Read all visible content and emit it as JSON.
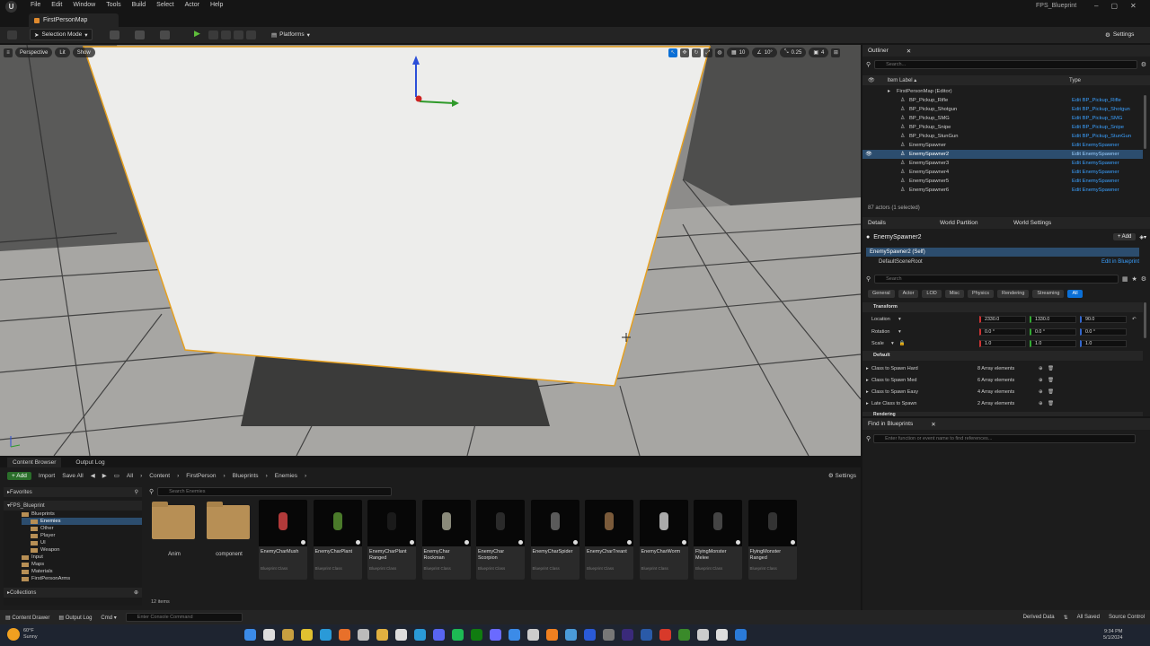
{
  "titlebar": {
    "logo": "U",
    "menu": [
      "File",
      "Edit",
      "Window",
      "Tools",
      "Build",
      "Select",
      "Actor",
      "Help"
    ],
    "project": "FPS_Blueprint",
    "tab": "FirstPersonMap",
    "window_controls": [
      "–",
      "▢",
      "✕"
    ]
  },
  "toolbar": {
    "mode": "Selection Mode",
    "platforms": "Platforms",
    "settings": "Settings"
  },
  "viewport": {
    "perspective": "Perspective",
    "lit": "Lit",
    "show": "Show",
    "grid": "10",
    "angle": "10°",
    "scale": "0.25",
    "camera": "4"
  },
  "outliner": {
    "title": "Outliner",
    "search_placeholder": "Search...",
    "col_label": "Item Label ▴",
    "col_type": "Type",
    "rows": [
      {
        "label": "FirstPersonMap (Editor)",
        "type": "",
        "indent": 1
      },
      {
        "label": "BP_Pickup_Rifle",
        "type": "Edit BP_Pickup_Rifle",
        "indent": 2
      },
      {
        "label": "BP_Pickup_Shotgun",
        "type": "Edit BP_Pickup_Shotgun",
        "indent": 2
      },
      {
        "label": "BP_Pickup_SMG",
        "type": "Edit BP_Pickup_SMG",
        "indent": 2
      },
      {
        "label": "BP_Pickup_Snipe",
        "type": "Edit BP_Pickup_Snipe",
        "indent": 2
      },
      {
        "label": "BP_Pickup_StunGun",
        "type": "Edit BP_Pickup_StunGun",
        "indent": 2
      },
      {
        "label": "EnemySpawner",
        "type": "Edit EnemySpawner",
        "indent": 2
      },
      {
        "label": "EnemySpawner2",
        "type": "Edit EnemySpawner",
        "indent": 2,
        "selected": true
      },
      {
        "label": "EnemySpawner3",
        "type": "Edit EnemySpawner",
        "indent": 2
      },
      {
        "label": "EnemySpawner4",
        "type": "Edit EnemySpawner",
        "indent": 2
      },
      {
        "label": "EnemySpawner5",
        "type": "Edit EnemySpawner",
        "indent": 2
      },
      {
        "label": "EnemySpawner6",
        "type": "Edit EnemySpawner",
        "indent": 2
      }
    ],
    "footer": "87 actors (1 selected)"
  },
  "details": {
    "tabs": [
      "Details",
      "World Partition",
      "World Settings"
    ],
    "actor": "EnemySpawner2",
    "add": "+ Add",
    "self": "EnemySpawner2 (Self)",
    "root": "DefaultSceneRoot",
    "edit_bp": "Edit in Blueprint",
    "search_placeholder": "Search",
    "filters": [
      "General",
      "Actor",
      "LOD",
      "Misc",
      "Physics",
      "Rendering",
      "Streaming",
      "All"
    ],
    "transform": "Transform",
    "location": {
      "label": "Location",
      "x": "2330.0",
      "y": "1330.0",
      "z": "90.0"
    },
    "rotation": {
      "label": "Rotation",
      "x": "0.0 °",
      "y": "0.0 °",
      "z": "0.0 °"
    },
    "scale": {
      "label": "Scale",
      "x": "1.0",
      "y": "1.0",
      "z": "1.0"
    },
    "default": "Default",
    "props": [
      {
        "label": "Class to Spawn Hard",
        "value": "8 Array elements"
      },
      {
        "label": "Class to Spawn Med",
        "value": "6 Array elements"
      },
      {
        "label": "Class to Spawn Easy",
        "value": "4 Array elements"
      },
      {
        "label": "Late Class to Spawn",
        "value": "2 Array elements"
      }
    ],
    "next_section": "Rendering"
  },
  "findbp": {
    "title": "Find in Blueprints",
    "placeholder": "Enter function or event name to find references..."
  },
  "cb": {
    "tabs": [
      "Content Browser",
      "Output Log"
    ],
    "add": "+ Add",
    "import": "Import",
    "save": "Save All",
    "crumbs": [
      "All",
      "Content",
      "FirstPerson",
      "Blueprints",
      "Enemies"
    ],
    "settings": "Settings",
    "favorites": "Favorites",
    "root": "FPS_Blueprint",
    "search_placeholder": "Search Enemies",
    "tree": [
      "Blueprints",
      "Enemies",
      "Other",
      "Player",
      "UI",
      "Weapon",
      "Input",
      "Maps",
      "Materials",
      "FirstPersonArms"
    ],
    "collections": "Collections",
    "folders": [
      "Anim",
      "component"
    ],
    "assets": [
      {
        "name": "EnemyCharMush",
        "type": "Blueprint Class"
      },
      {
        "name": "EnemyCharPlant",
        "type": "Blueprint Class"
      },
      {
        "name": "EnemyCharPlant Ranged",
        "type": "Blueprint Class"
      },
      {
        "name": "EnemyChar Rockman",
        "type": "Blueprint Class"
      },
      {
        "name": "EnemyChar Scorpion",
        "type": "Blueprint Class"
      },
      {
        "name": "EnemyCharSpider",
        "type": "Blueprint Class"
      },
      {
        "name": "EnemyCharTreant",
        "type": "Blueprint Class"
      },
      {
        "name": "EnemyCharWorm",
        "type": "Blueprint Class"
      },
      {
        "name": "FlyingMonster Melee",
        "type": "Blueprint Class"
      },
      {
        "name": "FlyingMonster Ranged",
        "type": "Blueprint Class"
      }
    ],
    "count": "12 items"
  },
  "status": {
    "drawer": "Content Drawer",
    "log": "Output Log",
    "cmd": "Cmd ▾",
    "console": "Enter Console Command",
    "derived": "Derived Data",
    "saved": "All Saved",
    "source": "Source Control"
  },
  "taskbar": {
    "temp": "60°F",
    "weather": "Sunny",
    "time": "9:34 PM",
    "date": "5/1/2024"
  }
}
